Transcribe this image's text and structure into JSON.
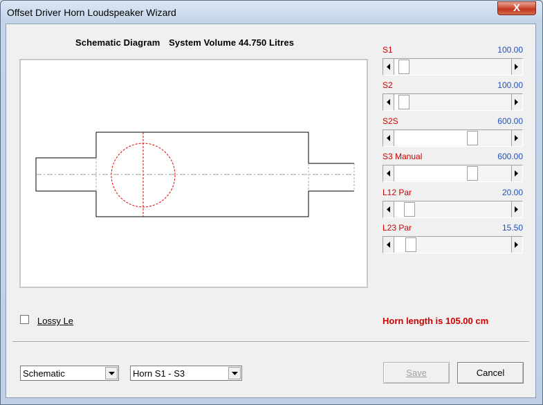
{
  "window": {
    "title": "Offset Driver Horn Loudspeaker Wizard",
    "close_glyph": "X"
  },
  "diagram": {
    "label": "Schematic Diagram",
    "volume_text": "System Volume 44.750 Litres"
  },
  "sliders": [
    {
      "label": "S1",
      "value": "100.00",
      "position": 0.04
    },
    {
      "label": "S2",
      "value": "100.00",
      "position": 0.04
    },
    {
      "label": "S2S",
      "value": "600.00",
      "position": 0.68
    },
    {
      "label": "S3 Manual",
      "value": "600.00",
      "position": 0.68
    },
    {
      "label": "L12 Par",
      "value": "20.00",
      "position": 0.09
    },
    {
      "label": "L23 Par",
      "value": "15.50",
      "position": 0.1
    }
  ],
  "lossy": {
    "label": "Lossy Le",
    "checked": false
  },
  "status": {
    "horn_length": "Horn length is 105.00 cm"
  },
  "dropdowns": {
    "view": "Schematic",
    "section": "Horn S1 - S3"
  },
  "buttons": {
    "save": "Save",
    "cancel": "Cancel"
  },
  "colors": {
    "label_red": "#cc0000",
    "value_blue": "#1f4fc0",
    "schematic_red": "#dd0000"
  }
}
